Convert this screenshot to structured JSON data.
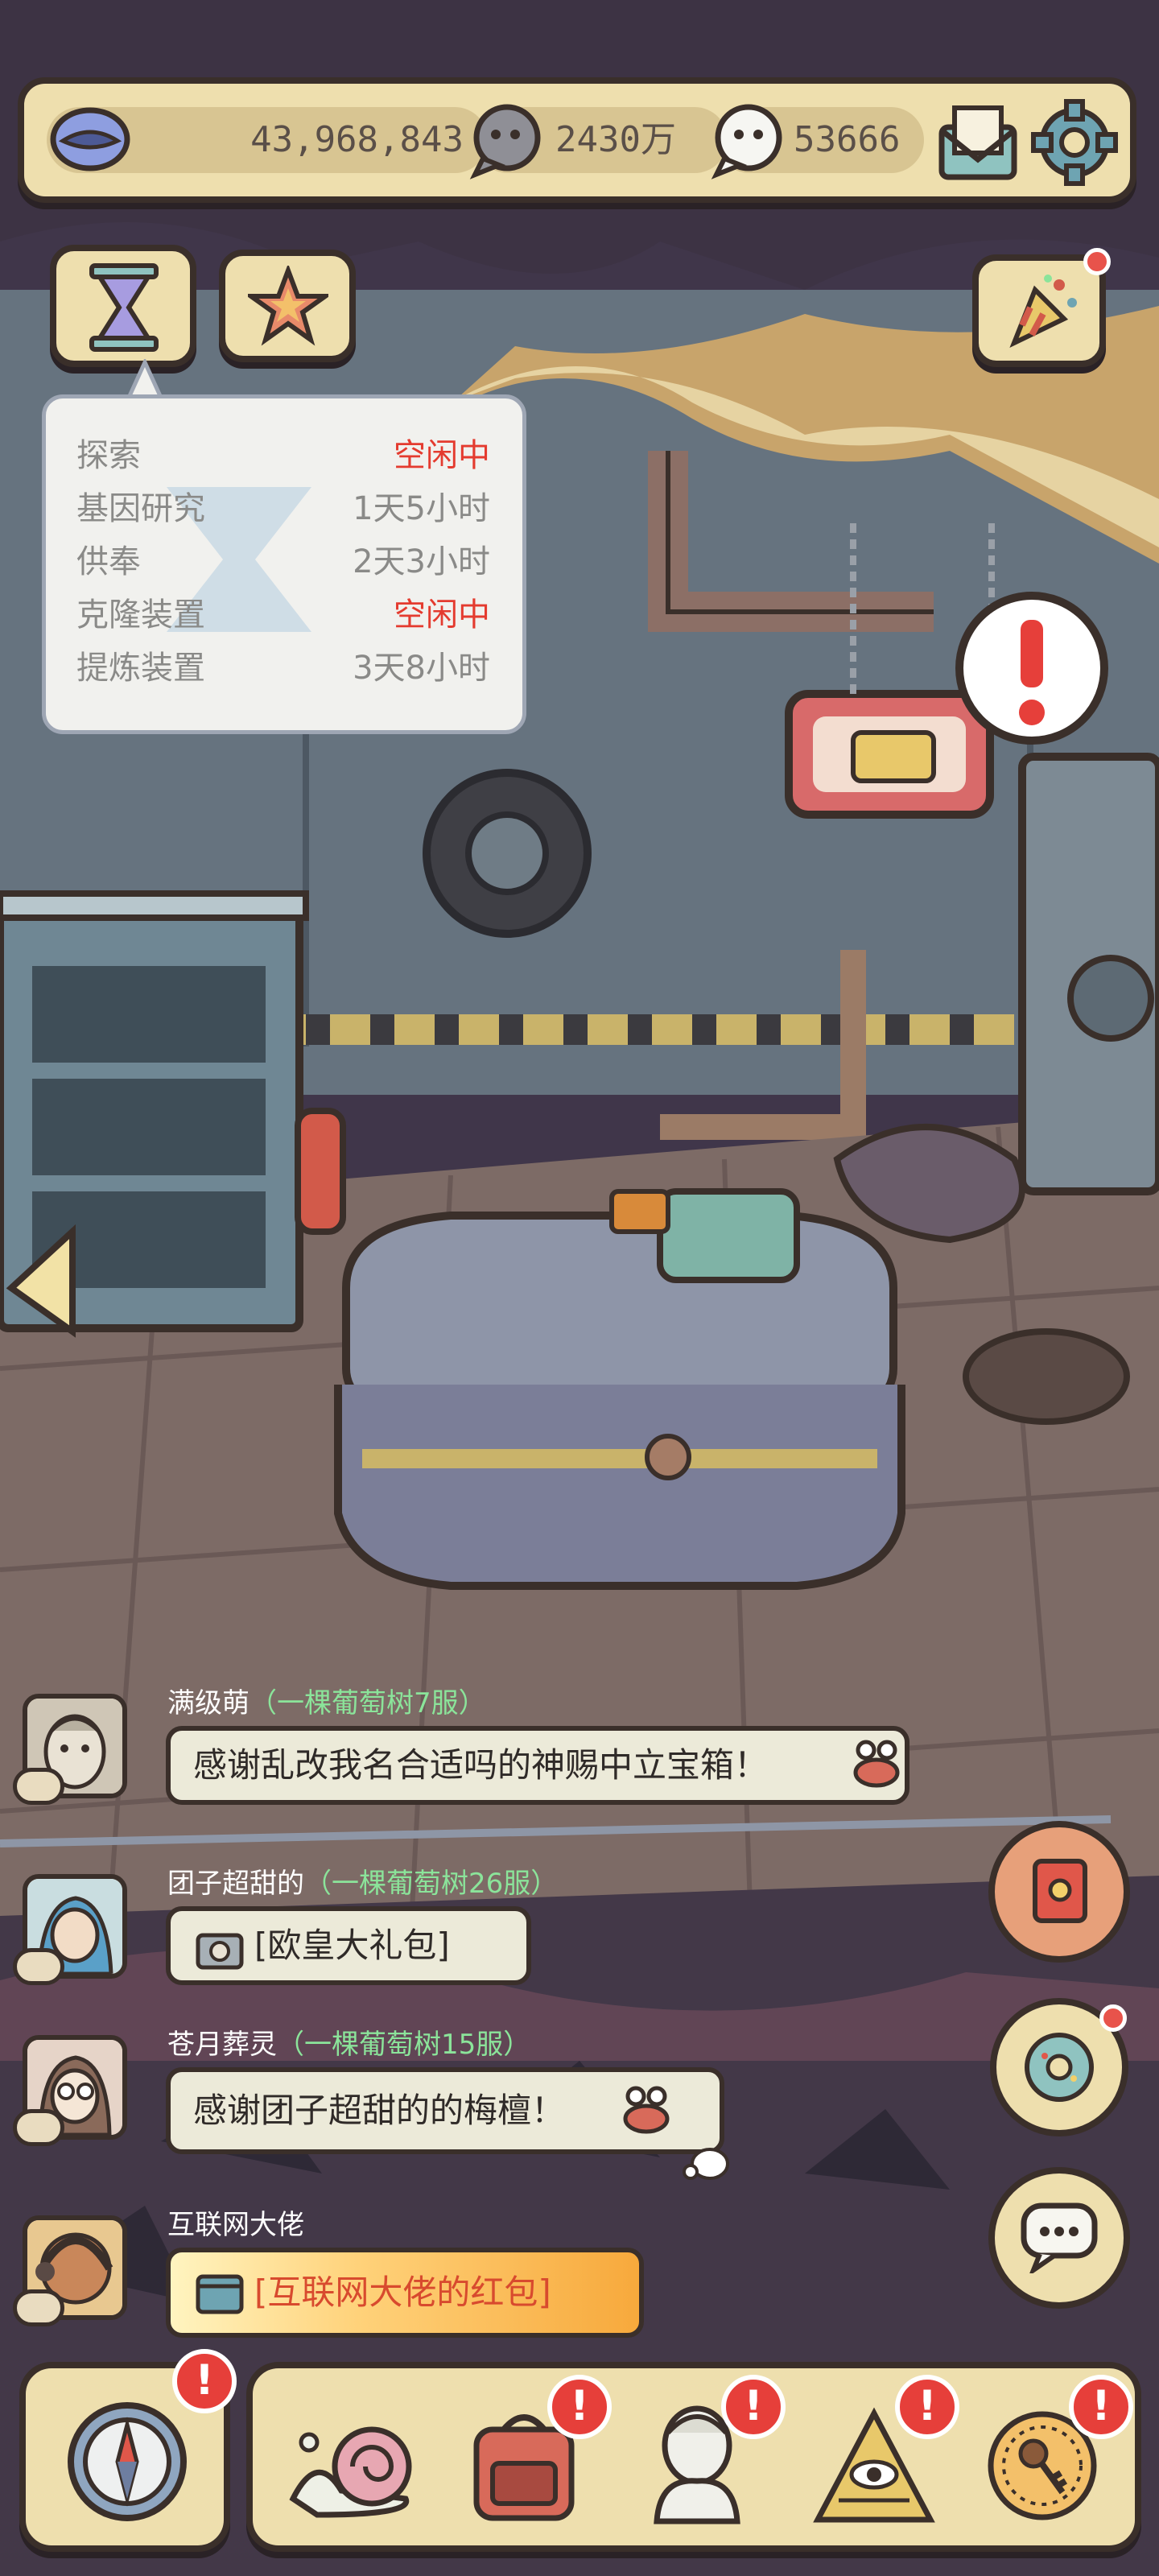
{
  "resources": {
    "gold": "43,968,843",
    "gray_bubbles": "2430万",
    "white_bubbles": "53666"
  },
  "status_popup": {
    "rows": [
      {
        "label": "探索",
        "value": "空闲中",
        "idle": true
      },
      {
        "label": "基因研究",
        "value": "1天5小时",
        "idle": false
      },
      {
        "label": "供奉",
        "value": "2天3小时",
        "idle": false
      },
      {
        "label": "克隆装置",
        "value": "空闲中",
        "idle": true
      },
      {
        "label": "提炼装置",
        "value": "3天8小时",
        "idle": false
      }
    ]
  },
  "chat": [
    {
      "user": "满级萌",
      "server": "（一棵葡萄树7服）",
      "message": "感谢乱改我名合适吗的神赐中立宝箱！",
      "type": "text"
    },
    {
      "user": "团子超甜的",
      "server": "（一棵葡萄树26服）",
      "message": "[欧皇大礼包]",
      "type": "gift"
    },
    {
      "user": "苍月葬灵",
      "server": "（一棵葡萄树15服）",
      "message": "感谢团子超甜的的梅檀！",
      "type": "text"
    },
    {
      "user": "互联网大佬",
      "server": "",
      "message": "[互联网大佬的红包]",
      "type": "redpacket"
    }
  ],
  "icons": {
    "top_bar": [
      "lips-icon",
      "gray-speech-icon",
      "white-ghost-icon",
      "mail-icon",
      "gear-icon"
    ],
    "left_buttons": [
      "hourglass-icon",
      "star-icon"
    ],
    "right_buttons": [
      "party-popper-icon",
      "red-envelope-icon",
      "donut-icon",
      "chat-icon"
    ],
    "bottom_nav": [
      "compass-icon",
      "snail-icon",
      "backpack-icon",
      "bust-statue-icon",
      "eye-pyramid-icon",
      "key-coin-icon"
    ]
  },
  "colors": {
    "panel": "#eedfae",
    "outline": "#3a2f2a",
    "idle_red": "#e43b2f",
    "server_green": "#8be49a",
    "alert_red": "#e63f3a"
  }
}
